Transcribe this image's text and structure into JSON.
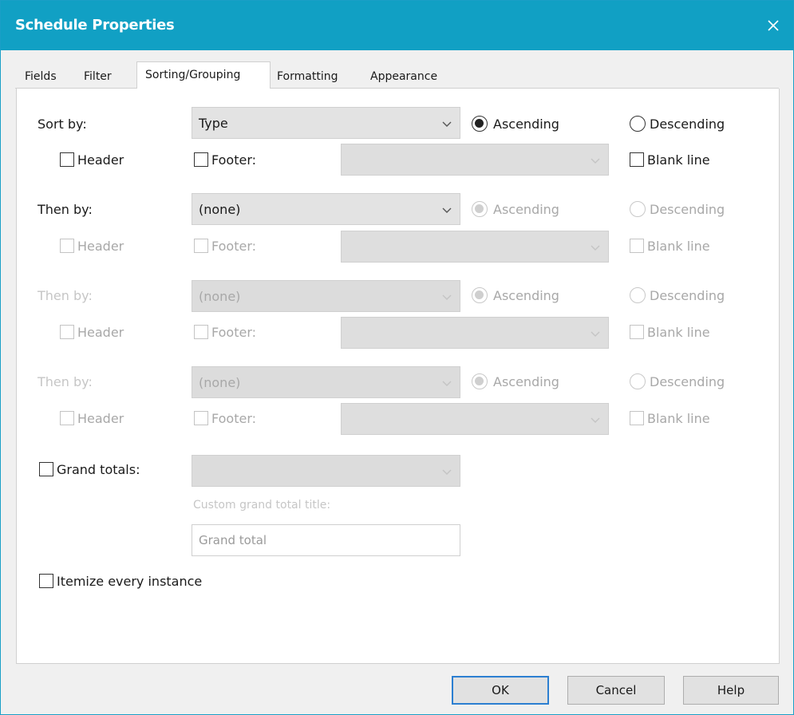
{
  "window": {
    "title": "Schedule Properties",
    "close_glyph": "✕"
  },
  "tabs": [
    "Fields",
    "Filter",
    "Sorting/Grouping",
    "Formatting",
    "Appearance"
  ],
  "active_tab": "Sorting/Grouping",
  "sort_rows": [
    {
      "label": "Sort by:",
      "value": "Type",
      "order": "Ascending",
      "ascending": "Ascending",
      "descending": "Descending",
      "header": "Header",
      "footer": "Footer:",
      "blank_line": "Blank line",
      "header_checked": false,
      "footer_checked": false,
      "blank_checked": false
    },
    {
      "label": "Then by:",
      "value": "(none)",
      "order": "Ascending",
      "ascending": "Ascending",
      "descending": "Descending",
      "header": "Header",
      "footer": "Footer:",
      "blank_line": "Blank line",
      "header_checked": false,
      "footer_checked": false,
      "blank_checked": false
    },
    {
      "label": "Then by:",
      "value": "(none)",
      "order": "Ascending",
      "ascending": "Ascending",
      "descending": "Descending",
      "header": "Header",
      "footer": "Footer:",
      "blank_line": "Blank line",
      "header_checked": false,
      "footer_checked": false,
      "blank_checked": false
    },
    {
      "label": "Then by:",
      "value": "(none)",
      "order": "Ascending",
      "ascending": "Ascending",
      "descending": "Descending",
      "header": "Header",
      "footer": "Footer:",
      "blank_line": "Blank line",
      "header_checked": false,
      "footer_checked": false,
      "blank_checked": false
    }
  ],
  "grand_totals": {
    "label": "Grand totals:",
    "checked": false,
    "value": "",
    "custom_title_label": "Custom grand total title:",
    "custom_title_value": "Grand total"
  },
  "itemize": {
    "label": "Itemize every instance",
    "checked": false
  },
  "buttons": {
    "ok": "OK",
    "cancel": "Cancel",
    "help": "Help"
  },
  "colors": {
    "titlebar": "#11a0c4",
    "default_button_border": "#2c7fd1"
  }
}
